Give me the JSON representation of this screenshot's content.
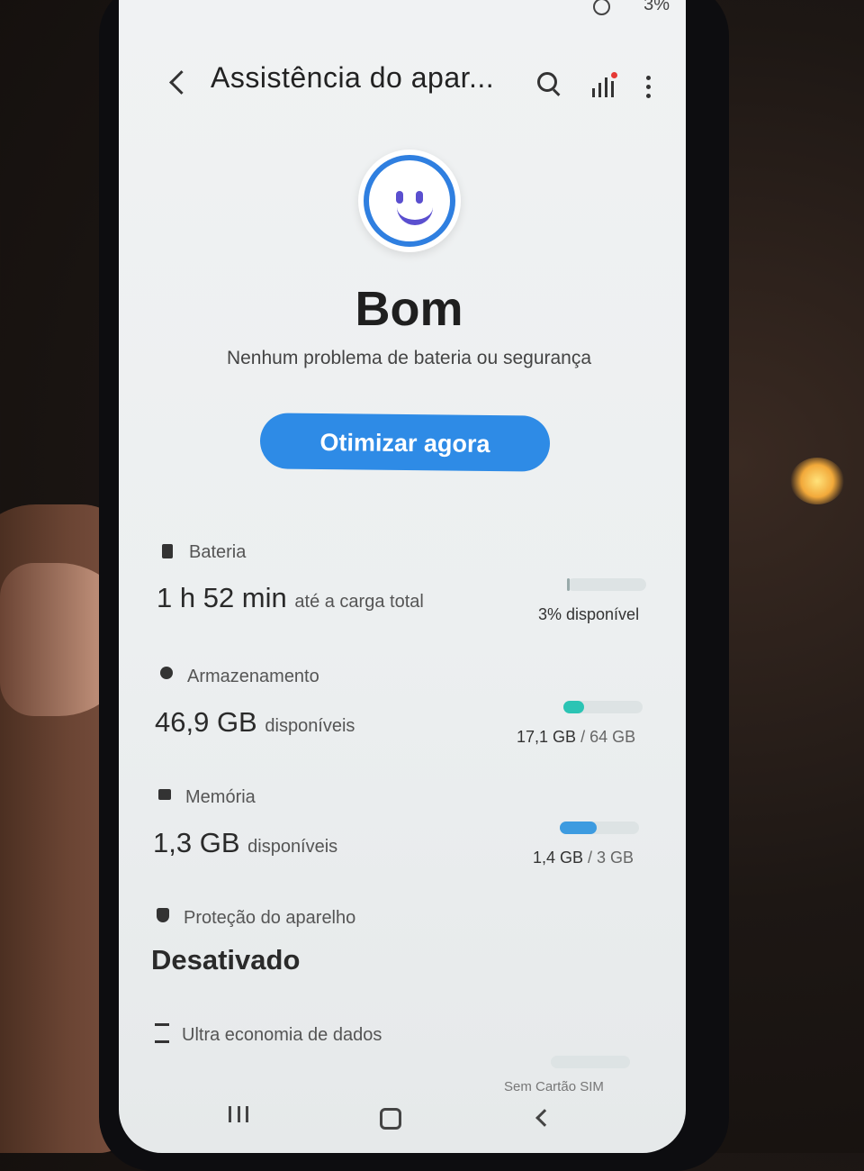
{
  "status_bar": {
    "battery": "3%"
  },
  "header": {
    "title": "Assistência do apar...",
    "icons": [
      "back-icon",
      "search-icon",
      "stats-icon",
      "more-vertical-icon"
    ]
  },
  "summary": {
    "face_icon": "smiley-face-icon",
    "status": "Bom",
    "subtitle": "Nenhum problema de bateria ou segurança",
    "button_label": "Otimizar agora",
    "accent_color": "#2e8be6"
  },
  "battery": {
    "label": "Bateria",
    "value": "1 h 52 min",
    "value_suffix": "até a carga total",
    "right": "3% disponível",
    "level": 0.03
  },
  "storage": {
    "label": "Armazenamento",
    "value": "46,9 GB",
    "value_suffix": "disponíveis",
    "used": "17,1 GB",
    "total": "/ 64 GB",
    "level": 0.267,
    "bar_color": "#2bc4b4"
  },
  "memory": {
    "label": "Memória",
    "value": "1,3 GB",
    "value_suffix": "disponíveis",
    "used": "1,4 GB",
    "total": "/ 3 GB",
    "level": 0.467,
    "bar_color": "#3d9be0"
  },
  "protection": {
    "label": "Proteção do aparelho",
    "value": "Desativado"
  },
  "data_saver": {
    "label": "Ultra economia de dados",
    "right": "Sem Cartão SIM"
  },
  "nav_bar": {
    "icons": [
      "recent-apps-icon",
      "home-icon",
      "back-icon"
    ]
  }
}
